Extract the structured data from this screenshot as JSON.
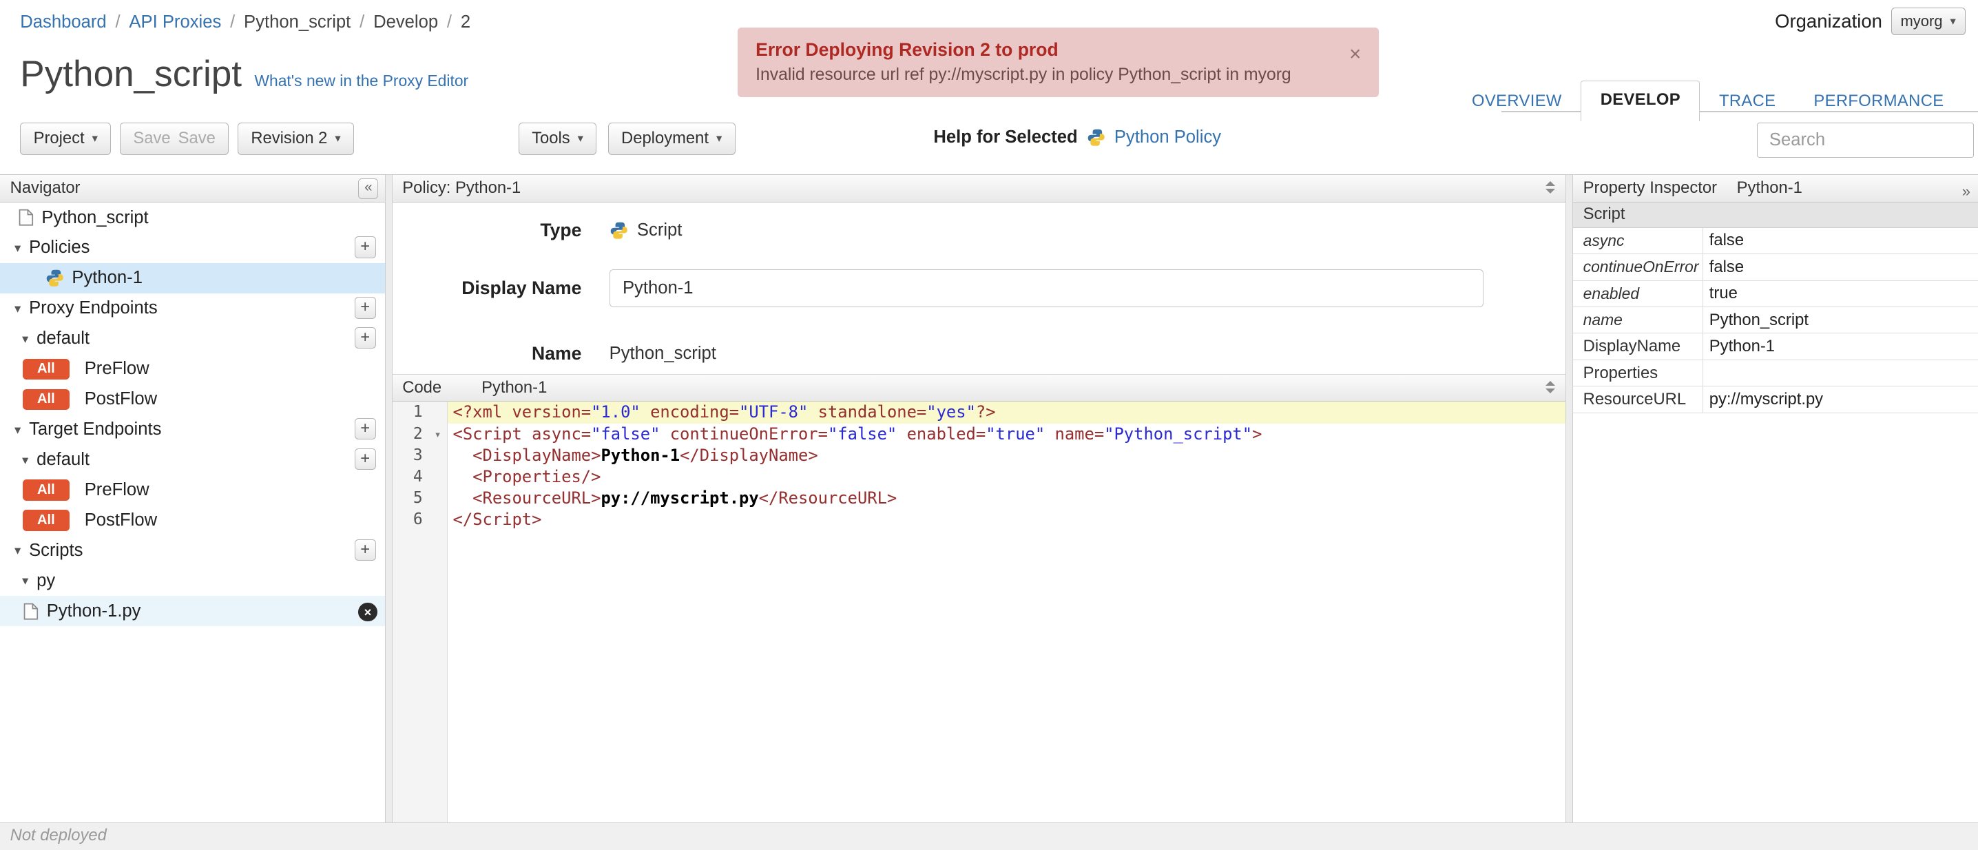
{
  "icons": {
    "caret_down": "▾",
    "collapse_left": "«",
    "expand_right": "»",
    "close": "×",
    "tree_expanded": "▾",
    "plus": "+",
    "delete_x": "×",
    "fold": "▾"
  },
  "breadcrumb": {
    "sep": "/",
    "items": [
      {
        "label": "Dashboard"
      },
      {
        "label": "API Proxies"
      },
      {
        "label": "Python_script"
      },
      {
        "label": "Develop"
      },
      {
        "label": "2"
      }
    ]
  },
  "org": {
    "label": "Organization",
    "value": "myorg"
  },
  "banner": {
    "title": "Error Deploying Revision 2 to prod",
    "message": "Invalid resource url ref py://myscript.py in policy Python_script in myorg"
  },
  "page": {
    "title": "Python_script",
    "whats_new": "What's new in the Proxy Editor"
  },
  "tabs": {
    "overview": "OVERVIEW",
    "develop": "DEVELOP",
    "trace": "TRACE",
    "performance": "PERFORMANCE"
  },
  "toolbar": {
    "project": "Project",
    "save": "Save",
    "revision": "Revision 2",
    "tools": "Tools",
    "deployment": "Deployment",
    "help_label": "Help for Selected",
    "help_link": "Python Policy",
    "search_placeholder": "Search"
  },
  "navigator": {
    "title": "Navigator",
    "root": "Python_script",
    "policies": {
      "label": "Policies",
      "child": "Python-1"
    },
    "proxy_endpoints": {
      "label": "Proxy Endpoints",
      "group": "default",
      "flows": [
        {
          "badge": "All",
          "label": "PreFlow"
        },
        {
          "badge": "All",
          "label": "PostFlow"
        }
      ]
    },
    "target_endpoints": {
      "label": "Target Endpoints",
      "group": "default",
      "flows": [
        {
          "badge": "All",
          "label": "PreFlow"
        },
        {
          "badge": "All",
          "label": "PostFlow"
        }
      ]
    },
    "scripts": {
      "label": "Scripts",
      "group": "py",
      "file": "Python-1.py"
    }
  },
  "policy_panel": {
    "title": "Policy: Python-1",
    "type_label": "Type",
    "type_value": "Script",
    "display_name_label": "Display Name",
    "display_name_value": "Python-1",
    "name_label": "Name",
    "name_value": "Python_script"
  },
  "code": {
    "header_left": "Code",
    "header_title": "Python-1",
    "lines": [
      {
        "n": "1",
        "fold": "",
        "hl": true,
        "tokens": [
          [
            "t",
            "<?xml "
          ],
          [
            "t",
            "version="
          ],
          [
            "v",
            "\"1.0\""
          ],
          [
            "t",
            " encoding="
          ],
          [
            "v",
            "\"UTF-8\""
          ],
          [
            "t",
            " standalone="
          ],
          [
            "v",
            "\"yes\""
          ],
          [
            "t",
            "?>"
          ]
        ]
      },
      {
        "n": "2",
        "fold": "▾",
        "hl": false,
        "tokens": [
          [
            "t",
            "<Script "
          ],
          [
            "t",
            "async="
          ],
          [
            "v",
            "\"false\""
          ],
          [
            "t",
            " continueOnError="
          ],
          [
            "v",
            "\"false\""
          ],
          [
            "t",
            " enabled="
          ],
          [
            "v",
            "\"true\""
          ],
          [
            "t",
            " name="
          ],
          [
            "v",
            "\"Python_script\""
          ],
          [
            "t",
            ">"
          ]
        ]
      },
      {
        "n": "3",
        "fold": "",
        "hl": false,
        "tokens": [
          [
            "p",
            "  "
          ],
          [
            "t",
            "<DisplayName>"
          ],
          [
            "x",
            "Python-1"
          ],
          [
            "t",
            "</DisplayName>"
          ]
        ]
      },
      {
        "n": "4",
        "fold": "",
        "hl": false,
        "tokens": [
          [
            "p",
            "  "
          ],
          [
            "t",
            "<Properties/>"
          ]
        ]
      },
      {
        "n": "5",
        "fold": "",
        "hl": false,
        "tokens": [
          [
            "p",
            "  "
          ],
          [
            "t",
            "<ResourceURL>"
          ],
          [
            "x",
            "py://myscript.py"
          ],
          [
            "t",
            "</ResourceURL>"
          ]
        ]
      },
      {
        "n": "6",
        "fold": "",
        "hl": false,
        "tokens": [
          [
            "t",
            "</Script>"
          ]
        ]
      }
    ]
  },
  "inspector": {
    "title": "Property Inspector",
    "subtitle": "Python-1",
    "section": "Script",
    "rows": [
      {
        "name": "async",
        "value": "false",
        "italic": true
      },
      {
        "name": "continueOnError",
        "value": "false",
        "italic": true
      },
      {
        "name": "enabled",
        "value": "true",
        "italic": true
      },
      {
        "name": "name",
        "value": "Python_script",
        "italic": true
      },
      {
        "name": "DisplayName",
        "value": "Python-1",
        "italic": false
      },
      {
        "name": "Properties",
        "value": "",
        "italic": false
      },
      {
        "name": "ResourceURL",
        "value": "py://myscript.py",
        "italic": false
      }
    ]
  },
  "statusbar": {
    "text": "Not deployed"
  }
}
